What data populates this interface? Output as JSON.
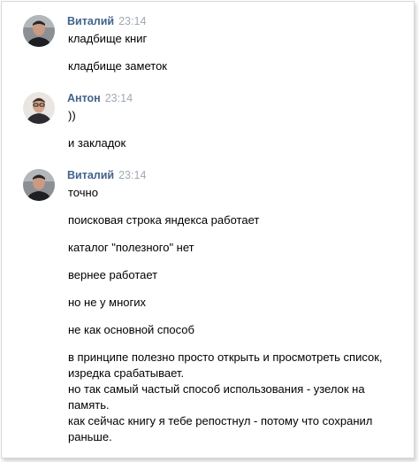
{
  "messages": [
    {
      "author": "Виталий",
      "time": "23:14",
      "avatar_icon": "user-avatar-vitaliy",
      "lines": [
        "кладбище книг",
        "кладбище заметок"
      ]
    },
    {
      "author": "Антон",
      "time": "23:14",
      "avatar_icon": "user-avatar-anton",
      "lines": [
        "))",
        "и закладок"
      ]
    },
    {
      "author": "Виталий",
      "time": "23:14",
      "avatar_icon": "user-avatar-vitaliy",
      "lines": [
        "точно",
        "поисковая строка яндекса работает",
        "каталог \"полезного\" нет",
        "вернее работает",
        "но не у многих",
        "не как основной способ",
        "в принципе полезно просто открыть и просмотреть список, изредка срабатывает.",
        "но так самый частый способ использования - узелок на память.",
        "как сейчас книгу я тебе репостнул - потому что сохранил раньше."
      ]
    }
  ],
  "colors": {
    "author": "#42648b",
    "time": "#a1a9b2",
    "border": "#d3d9de"
  }
}
